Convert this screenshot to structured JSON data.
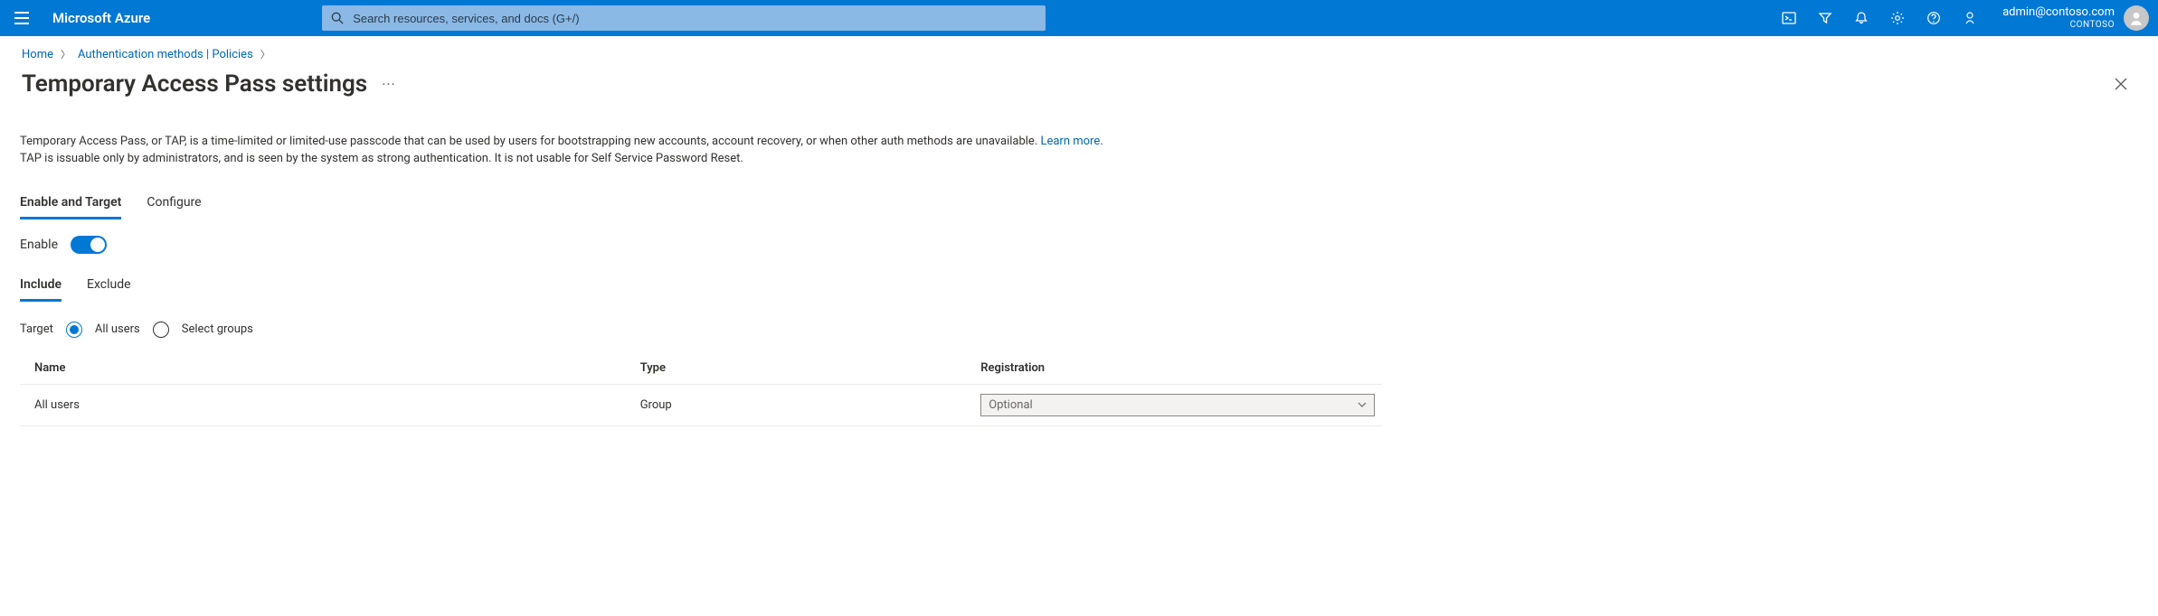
{
  "header": {
    "brand": "Microsoft Azure",
    "search_placeholder": "Search resources, services, and docs (G+/)",
    "account_email": "admin@contoso.com",
    "account_tenant": "CONTOSO"
  },
  "breadcrumb": {
    "items": [
      "Home",
      "Authentication methods | Policies"
    ]
  },
  "page": {
    "title": "Temporary Access Pass settings",
    "description_line1_pre": "Temporary Access Pass, or TAP, is a time-limited or limited-use passcode that can be used by users for bootstrapping new accounts, account recovery, or when other auth methods are unavailable. ",
    "learn_more": "Learn more",
    "description_line2": "TAP is issuable only by administrators, and is seen by the system as strong authentication. It is not usable for Self Service Password Reset."
  },
  "tabs": {
    "enable_target": "Enable and Target",
    "configure": "Configure"
  },
  "enable": {
    "label": "Enable",
    "state": "on"
  },
  "subtabs": {
    "include": "Include",
    "exclude": "Exclude"
  },
  "target": {
    "label": "Target",
    "option_all": "All users",
    "option_groups": "Select groups"
  },
  "table": {
    "headers": {
      "name": "Name",
      "type": "Type",
      "registration": "Registration"
    },
    "rows": [
      {
        "name": "All users",
        "type": "Group",
        "registration": "Optional"
      }
    ]
  }
}
